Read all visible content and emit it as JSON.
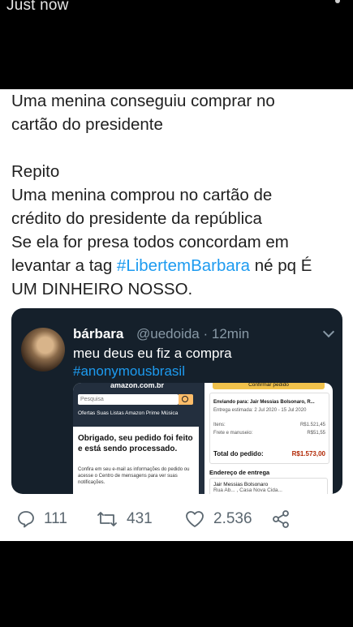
{
  "status": {
    "text": "Just now"
  },
  "tweet": {
    "lines": [
      {
        "text": "Uma menina conseguiu comprar no"
      },
      {
        "text": "cartão do presidente"
      },
      {
        "text": ""
      },
      {
        "text": "Repito"
      },
      {
        "text": "Uma menina comprou no cartão de"
      },
      {
        "text": "crédito do presidente da república"
      },
      {
        "text": "Se ela for presa todos concordam em"
      },
      {
        "text_before": "levantar a tag ",
        "hashtag": "#LibertemBarbara",
        "text_after": " né pq É"
      },
      {
        "text": "UM DINHEIRO NOSSO."
      }
    ]
  },
  "quote": {
    "name": "bárbara",
    "handle": "@uedoida · 12min",
    "text": "meu deus eu fiz a compra",
    "hashtag": "#anonymousbrasil",
    "screenshot": {
      "logo": "amazon.com.br",
      "search_placeholder": "Pesquisa",
      "nav": "Ofertas   Suas Listas   Amazon Prime   Música",
      "thanks": "Obrigado, seu pedido foi feito e está sendo processado.",
      "confirm_text": "Confira em seu e-mail as informações do pedido ou acesse o Centro de mensagens para ver suas notificações.",
      "yellow_button": "Confirmar pedido",
      "ship_to": "Enviando para: Jair Messias Bolsonaro, R...",
      "estimate": "Entrega estimada: 2 Jul 2020 - 15 Jul 2020",
      "items_label": "Itens:",
      "items_value": "R$1.521,45",
      "shipping_label": "Frete e manuseio:",
      "shipping_value": "R$51,55",
      "total_label": "Total do pedido:",
      "total_value": "R$1.573,00",
      "address_title": "Endereço de entrega",
      "address_name": "Jair Messias Bolsonaro",
      "address_line": "Rua Ab...  , Casa Nova Cida..."
    }
  },
  "actions": {
    "replies": "111",
    "retweets": "431",
    "likes": "2.536"
  },
  "colors": {
    "hashtag": "#1d9bf0",
    "quote_bg": "#15202b",
    "icon_gray": "#5b6770"
  }
}
